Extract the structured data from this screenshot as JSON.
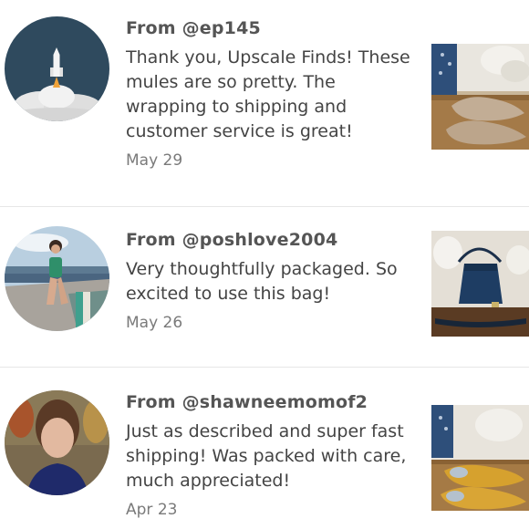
{
  "reviews": [
    {
      "from": "From @ep145",
      "text": "Thank you, Upscale Finds! These mules are so pretty. The wrapping to shipping and customer service is great!",
      "date": "May 29",
      "avatar_icon": "rocket-launch-avatar",
      "product_icon": "tan-suede-mules-photo"
    },
    {
      "from": "From @poshlove2004",
      "text": "Very thoughtfully packaged. So excited to use this bag!",
      "date": "May 26",
      "avatar_icon": "beach-photo-avatar",
      "product_icon": "navy-crossbody-bag-photo"
    },
    {
      "from": "From @shawneemomof2",
      "text": "Just as described and super fast shipping! Was packed with care, much appreciated!",
      "date": "Apr 23",
      "avatar_icon": "portrait-photo-avatar",
      "product_icon": "mustard-ballet-flats-photo"
    }
  ],
  "colors": {
    "divider": "#e6e6e6",
    "username": "#555555",
    "body_text": "#444444",
    "date_text": "#7a7a7a",
    "avatar_navy": "#2f4a5e"
  }
}
